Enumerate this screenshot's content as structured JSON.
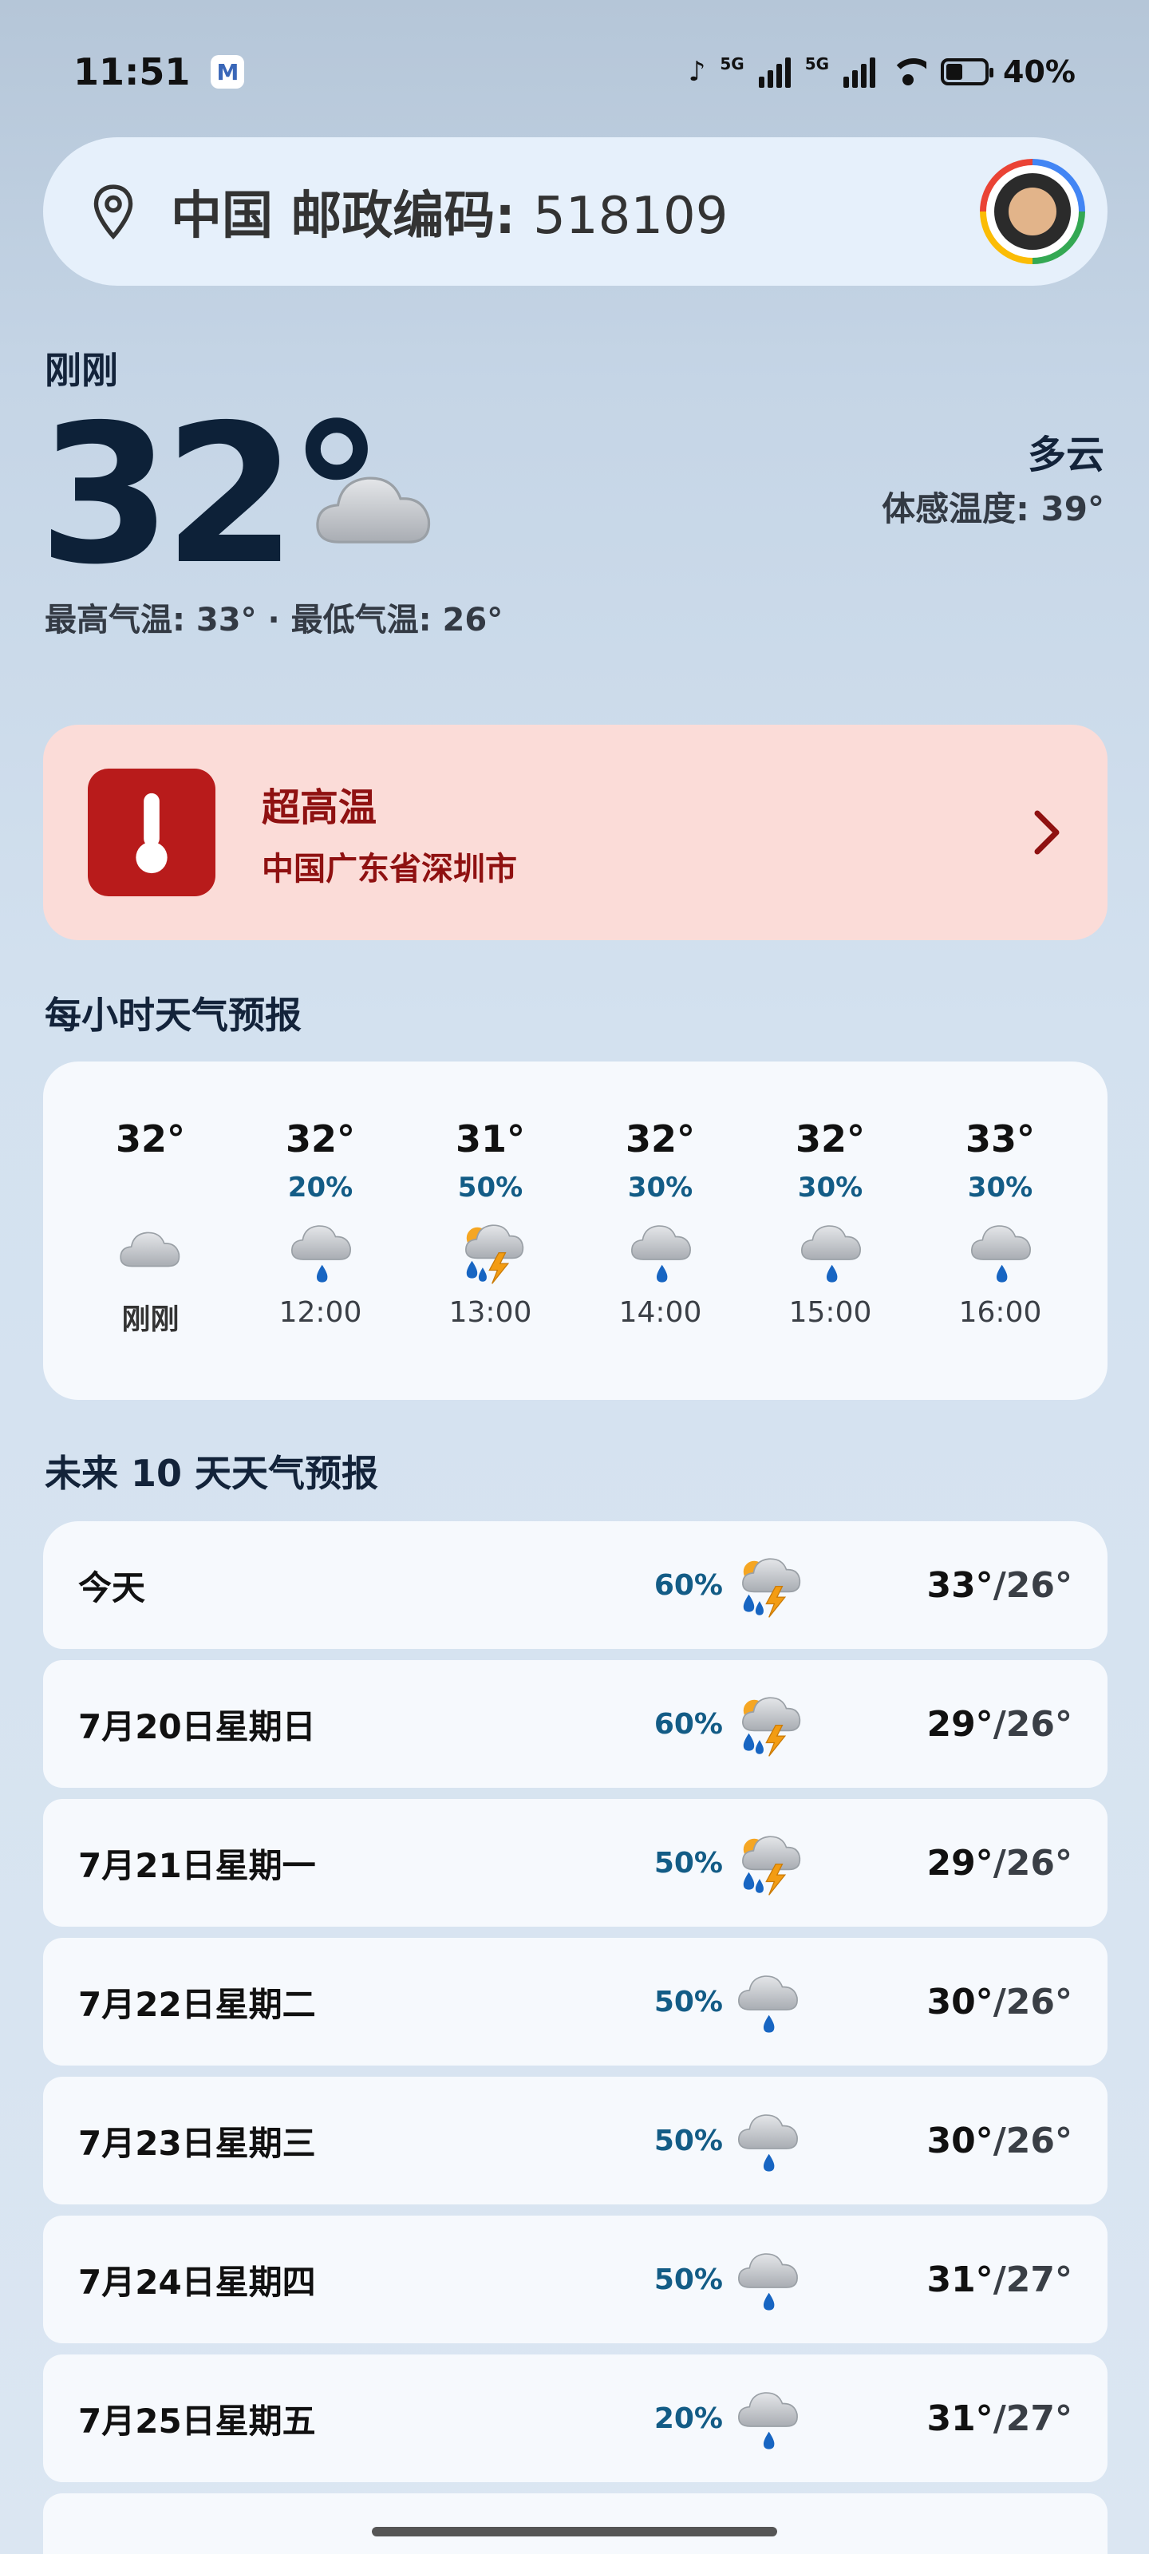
{
  "status": {
    "time": "11:51",
    "app_badge": "M",
    "sig1": "5G",
    "sig2": "5G",
    "battery_pct": "40%"
  },
  "search": {
    "location": "中国 邮政编码:",
    "zip": "518109"
  },
  "current": {
    "updated": "刚刚",
    "temp": "32°",
    "condition": "多云",
    "feels_like": "体感温度: 39°",
    "hi_lo": "最高气温: 33° · 最低气温: 26°"
  },
  "alert": {
    "title": "超高温",
    "location": "中国广东省深圳市",
    "color": "#b81b1b"
  },
  "hourly": {
    "title": "每小时天气预报",
    "items": [
      {
        "temp": "32°",
        "pop": "",
        "icon": "cloud-icon",
        "time": "刚刚"
      },
      {
        "temp": "32°",
        "pop": "20%",
        "icon": "rain-icon",
        "time": "12:00"
      },
      {
        "temp": "31°",
        "pop": "50%",
        "icon": "thunderstorm-icon",
        "time": "13:00"
      },
      {
        "temp": "32°",
        "pop": "30%",
        "icon": "rain-icon",
        "time": "14:00"
      },
      {
        "temp": "32°",
        "pop": "30%",
        "icon": "rain-icon",
        "time": "15:00"
      },
      {
        "temp": "33°",
        "pop": "30%",
        "icon": "rain-icon",
        "time": "16:00"
      }
    ]
  },
  "daily": {
    "title": "未来 10 天天气预报",
    "items": [
      {
        "label": "今天",
        "pop": "60%",
        "icon": "thunderstorm-icon",
        "hi": "33°",
        "lo": "/26°"
      },
      {
        "label": "7月20日星期日",
        "pop": "60%",
        "icon": "thunderstorm-icon",
        "hi": "29°",
        "lo": "/26°"
      },
      {
        "label": "7月21日星期一",
        "pop": "50%",
        "icon": "thunderstorm-icon",
        "hi": "29°",
        "lo": "/26°"
      },
      {
        "label": "7月22日星期二",
        "pop": "50%",
        "icon": "rain-icon",
        "hi": "30°",
        "lo": "/26°"
      },
      {
        "label": "7月23日星期三",
        "pop": "50%",
        "icon": "rain-icon",
        "hi": "30°",
        "lo": "/26°"
      },
      {
        "label": "7月24日星期四",
        "pop": "50%",
        "icon": "rain-icon",
        "hi": "31°",
        "lo": "/27°"
      },
      {
        "label": "7月25日星期五",
        "pop": "20%",
        "icon": "rain-icon",
        "hi": "31°",
        "lo": "/27°"
      }
    ]
  },
  "colors": {
    "pop_text": "#135c86",
    "alert_bg": "#fbdcd8"
  }
}
